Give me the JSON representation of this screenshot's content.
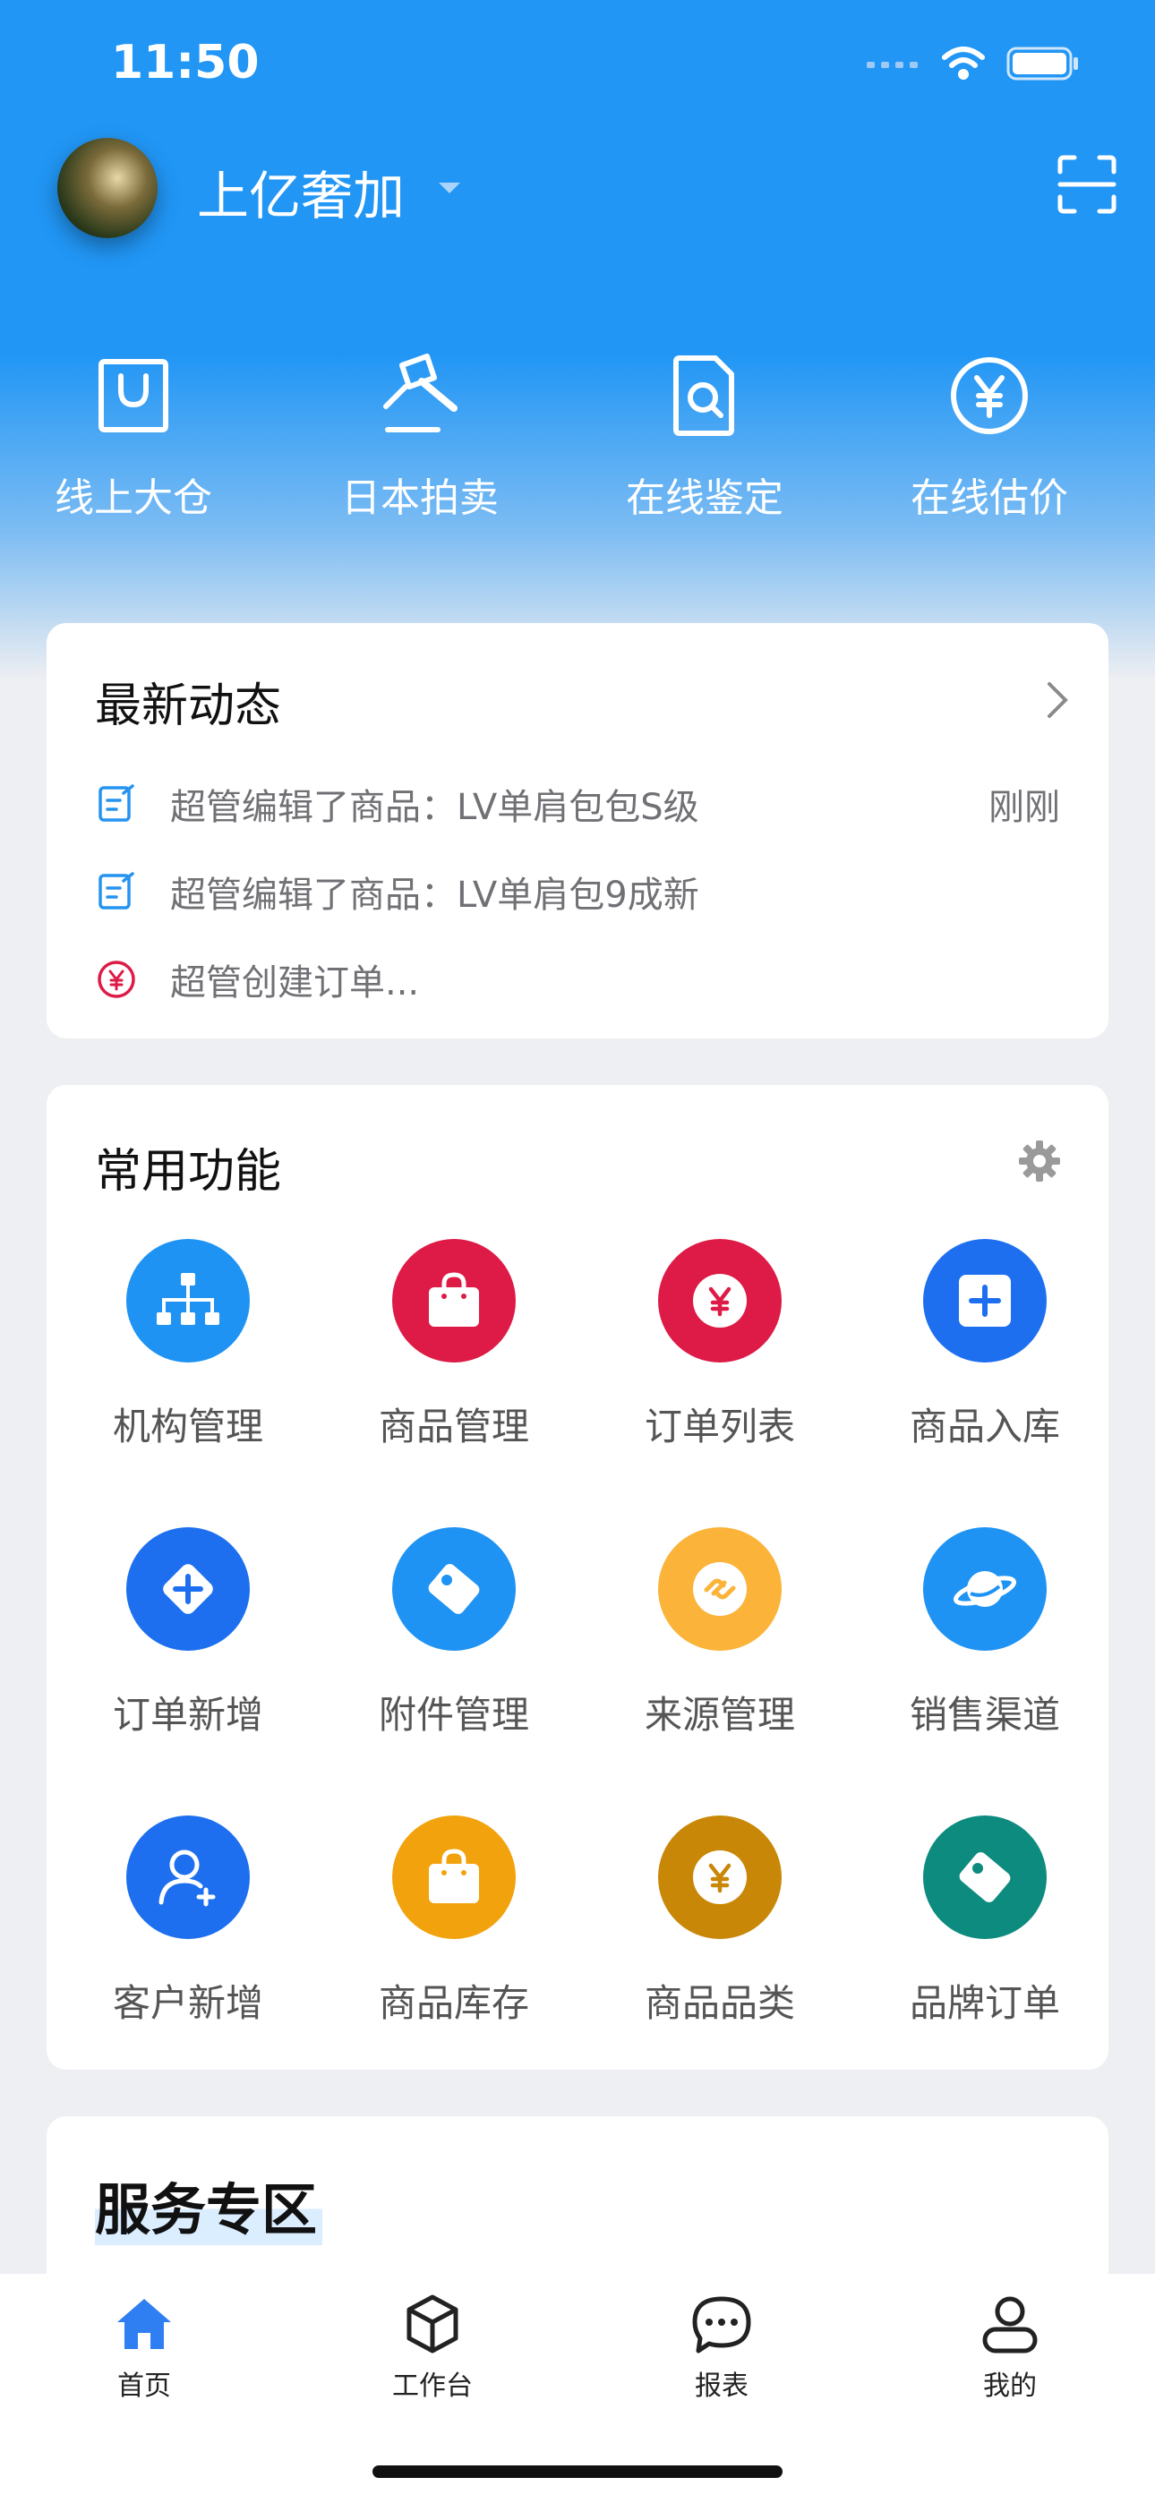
{
  "status_bar": {
    "time": "11:50"
  },
  "header": {
    "org_name": "上亿奢加"
  },
  "shortcuts": [
    {
      "label": "线上大仓",
      "icon": "shopping-bag-icon"
    },
    {
      "label": "日本拍卖",
      "icon": "gavel-icon"
    },
    {
      "label": "在线鉴定",
      "icon": "document-search-icon"
    },
    {
      "label": "在线估价",
      "icon": "yen-circle-icon"
    }
  ],
  "news": {
    "title": "最新动态",
    "items": [
      {
        "text": "超管编辑了商品：LV单肩包包S级",
        "time": "刚刚",
        "icon": "edit-document-icon"
      },
      {
        "text": "超管编辑了商品：LV单肩包9成新",
        "time": "",
        "icon": "edit-document-icon"
      },
      {
        "text": "超管创建订单...",
        "time": "",
        "icon": "yen-circle-icon"
      }
    ]
  },
  "functions": {
    "title": "常用功能",
    "items": [
      {
        "label": "机构管理",
        "icon": "org-tree-icon",
        "color": "#1f93f3"
      },
      {
        "label": "商品管理",
        "icon": "bag-icon",
        "color": "#dd1b46"
      },
      {
        "label": "订单列表",
        "icon": "yen-icon",
        "color": "#dd1b46"
      },
      {
        "label": "商品入库",
        "icon": "add-box-icon",
        "color": "#1d6ff0"
      },
      {
        "label": "订单新增",
        "icon": "add-diamond-icon",
        "color": "#1d6ff0"
      },
      {
        "label": "附件管理",
        "icon": "tag-icon",
        "color": "#1f93f3"
      },
      {
        "label": "来源管理",
        "icon": "link-icon",
        "color": "#fbb33a"
      },
      {
        "label": "销售渠道",
        "icon": "planet-icon",
        "color": "#1f93f3"
      },
      {
        "label": "客户新增",
        "icon": "add-user-icon",
        "color": "#1d6ff0"
      },
      {
        "label": "商品库存",
        "icon": "bag-icon",
        "color": "#f2a20c"
      },
      {
        "label": "商品品类",
        "icon": "yen-icon",
        "color": "#c98708"
      },
      {
        "label": "品牌订单",
        "icon": "tag-icon",
        "color": "#0c8b7e"
      }
    ]
  },
  "services": {
    "title": "服务专区"
  },
  "tabbar": {
    "items": [
      {
        "label": "首页",
        "icon": "home-icon",
        "active": true
      },
      {
        "label": "工作台",
        "icon": "cube-icon",
        "active": false
      },
      {
        "label": "报表",
        "icon": "chat-icon",
        "active": false
      },
      {
        "label": "我的",
        "icon": "user-icon",
        "active": false
      }
    ]
  }
}
